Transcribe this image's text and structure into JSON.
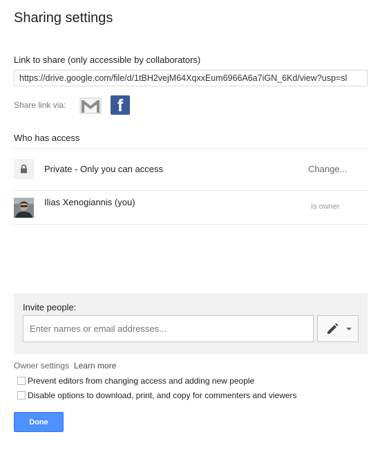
{
  "dialog": {
    "title": "Sharing settings"
  },
  "link": {
    "label": "Link to share (only accessible by collaborators)",
    "url": "https://drive.google.com/file/d/1tBH2vejM64XqxxEum6966A6a7iGN_6Kd/view?usp=sl"
  },
  "share_via": {
    "label": "Share link via:",
    "gmail_icon": "gmail-icon",
    "facebook_icon": "facebook-icon",
    "facebook_glyph": "f",
    "colors": {
      "facebook": "#3b5998",
      "gmail_red": "#d44638"
    }
  },
  "access": {
    "label": "Who has access",
    "private": {
      "text": "Private - Only you can access",
      "change": "Change..."
    },
    "user": {
      "name": "Ilias Xenogiannis (you)",
      "role": "Is owner"
    }
  },
  "invite": {
    "label": "Invite people:",
    "placeholder": "Enter names or email addresses...",
    "permission_icon": "pencil-icon"
  },
  "owner_settings": {
    "label": "Owner settings",
    "learn_more": "Learn more",
    "options": [
      {
        "label": "Prevent editors from changing access and adding new people",
        "checked": false
      },
      {
        "label": "Disable options to download, print, and copy for commenters and viewers",
        "checked": false
      }
    ]
  },
  "actions": {
    "done": "Done",
    "done_color": "#4d90fe"
  }
}
